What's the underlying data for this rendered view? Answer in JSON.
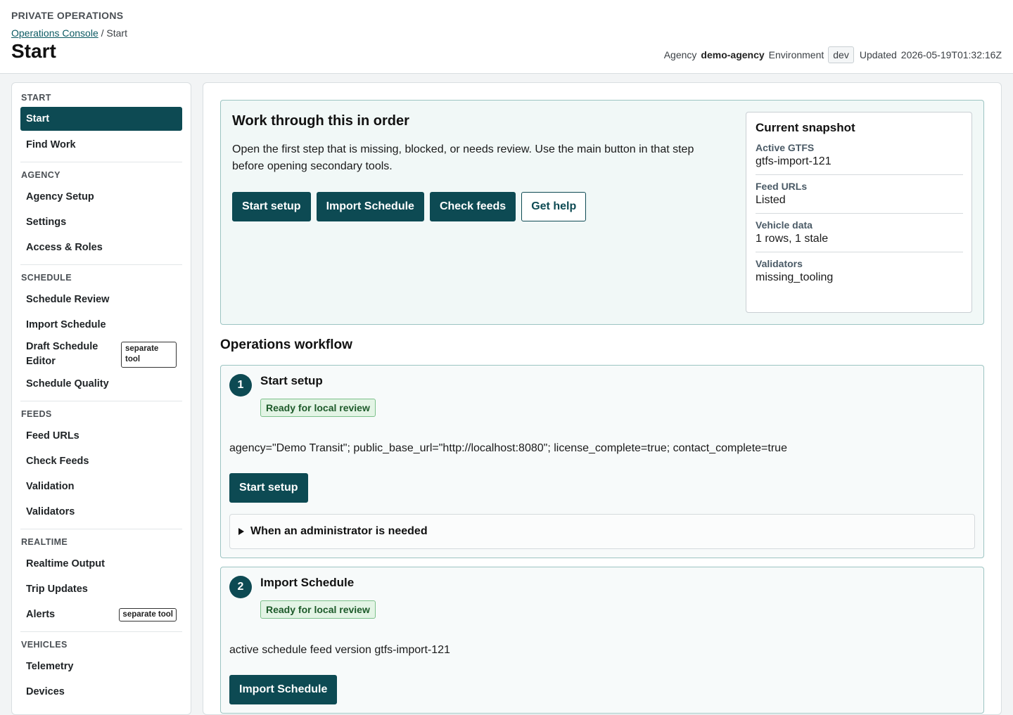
{
  "header": {
    "org_name": "PRIVATE OPERATIONS",
    "breadcrumb_link": "Operations Console",
    "breadcrumb_sep": "/",
    "breadcrumb_current": "Start",
    "title": "Start",
    "agency_label": "Agency",
    "agency_value": "demo-agency",
    "env_label": "Environment",
    "env_value": "dev",
    "updated_label": "Updated",
    "updated_value": "2026-05-19T01:32:16Z"
  },
  "sidebar": {
    "sections": [
      {
        "title": "START",
        "items": [
          {
            "label": "Start",
            "active": true
          },
          {
            "label": "Find Work"
          }
        ]
      },
      {
        "title": "AGENCY",
        "items": [
          {
            "label": "Agency Setup"
          },
          {
            "label": "Settings"
          },
          {
            "label": "Access & Roles"
          }
        ]
      },
      {
        "title": "SCHEDULE",
        "items": [
          {
            "label": "Schedule Review"
          },
          {
            "label": "Import Schedule"
          },
          {
            "label": "Draft Schedule Editor",
            "tag": "separate tool"
          },
          {
            "label": "Schedule Quality"
          }
        ]
      },
      {
        "title": "FEEDS",
        "items": [
          {
            "label": "Feed URLs"
          },
          {
            "label": "Check Feeds"
          },
          {
            "label": "Validation"
          },
          {
            "label": "Validators"
          }
        ]
      },
      {
        "title": "REALTIME",
        "items": [
          {
            "label": "Realtime Output"
          },
          {
            "label": "Trip Updates"
          },
          {
            "label": "Alerts",
            "tag": "separate tool"
          }
        ]
      },
      {
        "title": "VEHICLES",
        "items": [
          {
            "label": "Telemetry"
          },
          {
            "label": "Devices"
          }
        ]
      }
    ]
  },
  "intro": {
    "title": "Work through this in order",
    "text": "Open the first step that is missing, blocked, or needs review. Use the main button in that step before opening secondary tools.",
    "buttons": [
      "Start setup",
      "Import Schedule",
      "Check feeds"
    ],
    "help_button": "Get help"
  },
  "snapshot": {
    "title": "Current snapshot",
    "items": [
      {
        "label": "Active GTFS",
        "value": "gtfs-import-121"
      },
      {
        "label": "Feed URLs",
        "value": "Listed"
      },
      {
        "label": "Vehicle data",
        "value": "1 rows, 1 stale"
      },
      {
        "label": "Validators",
        "value": "missing_tooling"
      }
    ]
  },
  "workflow": {
    "title": "Operations workflow",
    "steps": [
      {
        "number": "1",
        "title": "Start setup",
        "status": "Ready for local review",
        "detail": "agency=\"Demo Transit\"; public_base_url=\"http://localhost:8080\"; license_complete=true; contact_complete=true",
        "button": "Start setup",
        "admin_summary": "When an administrator is needed"
      },
      {
        "number": "2",
        "title": "Import Schedule",
        "status": "Ready for local review",
        "detail": "active schedule feed version gtfs-import-121",
        "button": "Import Schedule"
      }
    ]
  }
}
